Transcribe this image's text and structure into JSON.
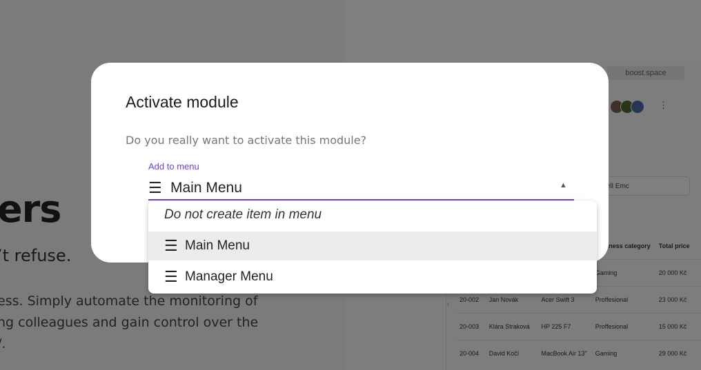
{
  "background": {
    "heading": "ers",
    "subheading": "’t refuse.",
    "paragraph_lines": [
      "ess. Simply automate the monitoring of",
      "ng colleagues and gain control over the",
      "/."
    ],
    "app": {
      "url": "boost.space",
      "filter_chip": "ell Emc",
      "add_icon": "+",
      "more_icon": "⋮",
      "table": {
        "headers": [
          "",
          "",
          "",
          "Business category",
          "Total price"
        ],
        "rows": [
          [
            "",
            "",
            "",
            "Gaming",
            "20 000 Kč"
          ],
          [
            "20-002",
            "Jan Novák",
            "Acer Swift 3",
            "Proffesional",
            "23 000 Kč"
          ],
          [
            "20-003",
            "Klára Straková",
            "HP 225 F7",
            "Proffesional",
            "15 000 Kč"
          ],
          [
            "20-004",
            "David Kočí",
            "MacBook Air 13\"",
            "Gaming",
            "29 000 Kč"
          ]
        ]
      }
    }
  },
  "dialog": {
    "title": "Activate module",
    "message": "Do you really want to activate this module?",
    "select": {
      "label": "Add to menu",
      "icon": "menu-lines-icon",
      "value": "Main Menu",
      "options": [
        {
          "label": "Do not create item in menu",
          "icon": ""
        },
        {
          "label": "Main Menu",
          "icon": "menu-lines-icon",
          "selected": true
        },
        {
          "label": "Manager Menu",
          "icon": "menu-lines-icon"
        }
      ]
    }
  },
  "colors": {
    "accent": "#6a3fd8",
    "scrim": "rgba(0,0,0,0.5)",
    "selected_option_bg": "#ececec"
  }
}
